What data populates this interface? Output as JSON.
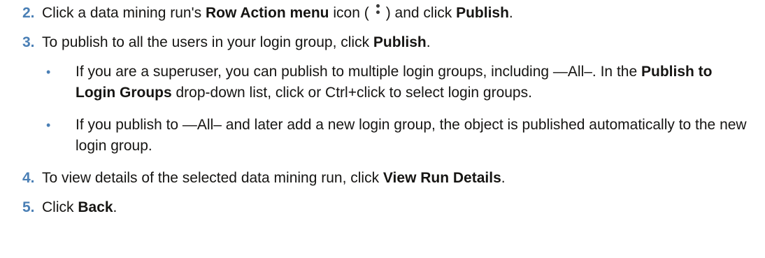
{
  "steps": [
    {
      "num": "2.",
      "pre": "Click a data mining run's ",
      "bold1": "Row Action menu",
      "mid": " icon (",
      "icon": "vertical-ellipsis-icon",
      "post": ") and click ",
      "bold2": "Publish",
      "end": "."
    },
    {
      "num": "3.",
      "pre": "To publish to all the users in your login group, click ",
      "bold1": "Publish",
      "end": ".",
      "bullets": [
        {
          "pre": "If you are a superuser, you can publish to multiple login groups, including —All–. In the ",
          "bold": "Publish to Login Groups",
          "post": " drop-down list, click or Ctrl+click to select login groups."
        },
        {
          "text": "If you publish to —All– and later add a new login group, the object is published automatically to the new login group."
        }
      ]
    },
    {
      "num": "4.",
      "pre": "To view details of the selected data mining run, click ",
      "bold1": "View Run Details",
      "end": "."
    },
    {
      "num": "5.",
      "pre": "Click ",
      "bold1": "Back",
      "end": "."
    }
  ],
  "bullet_char": "•"
}
